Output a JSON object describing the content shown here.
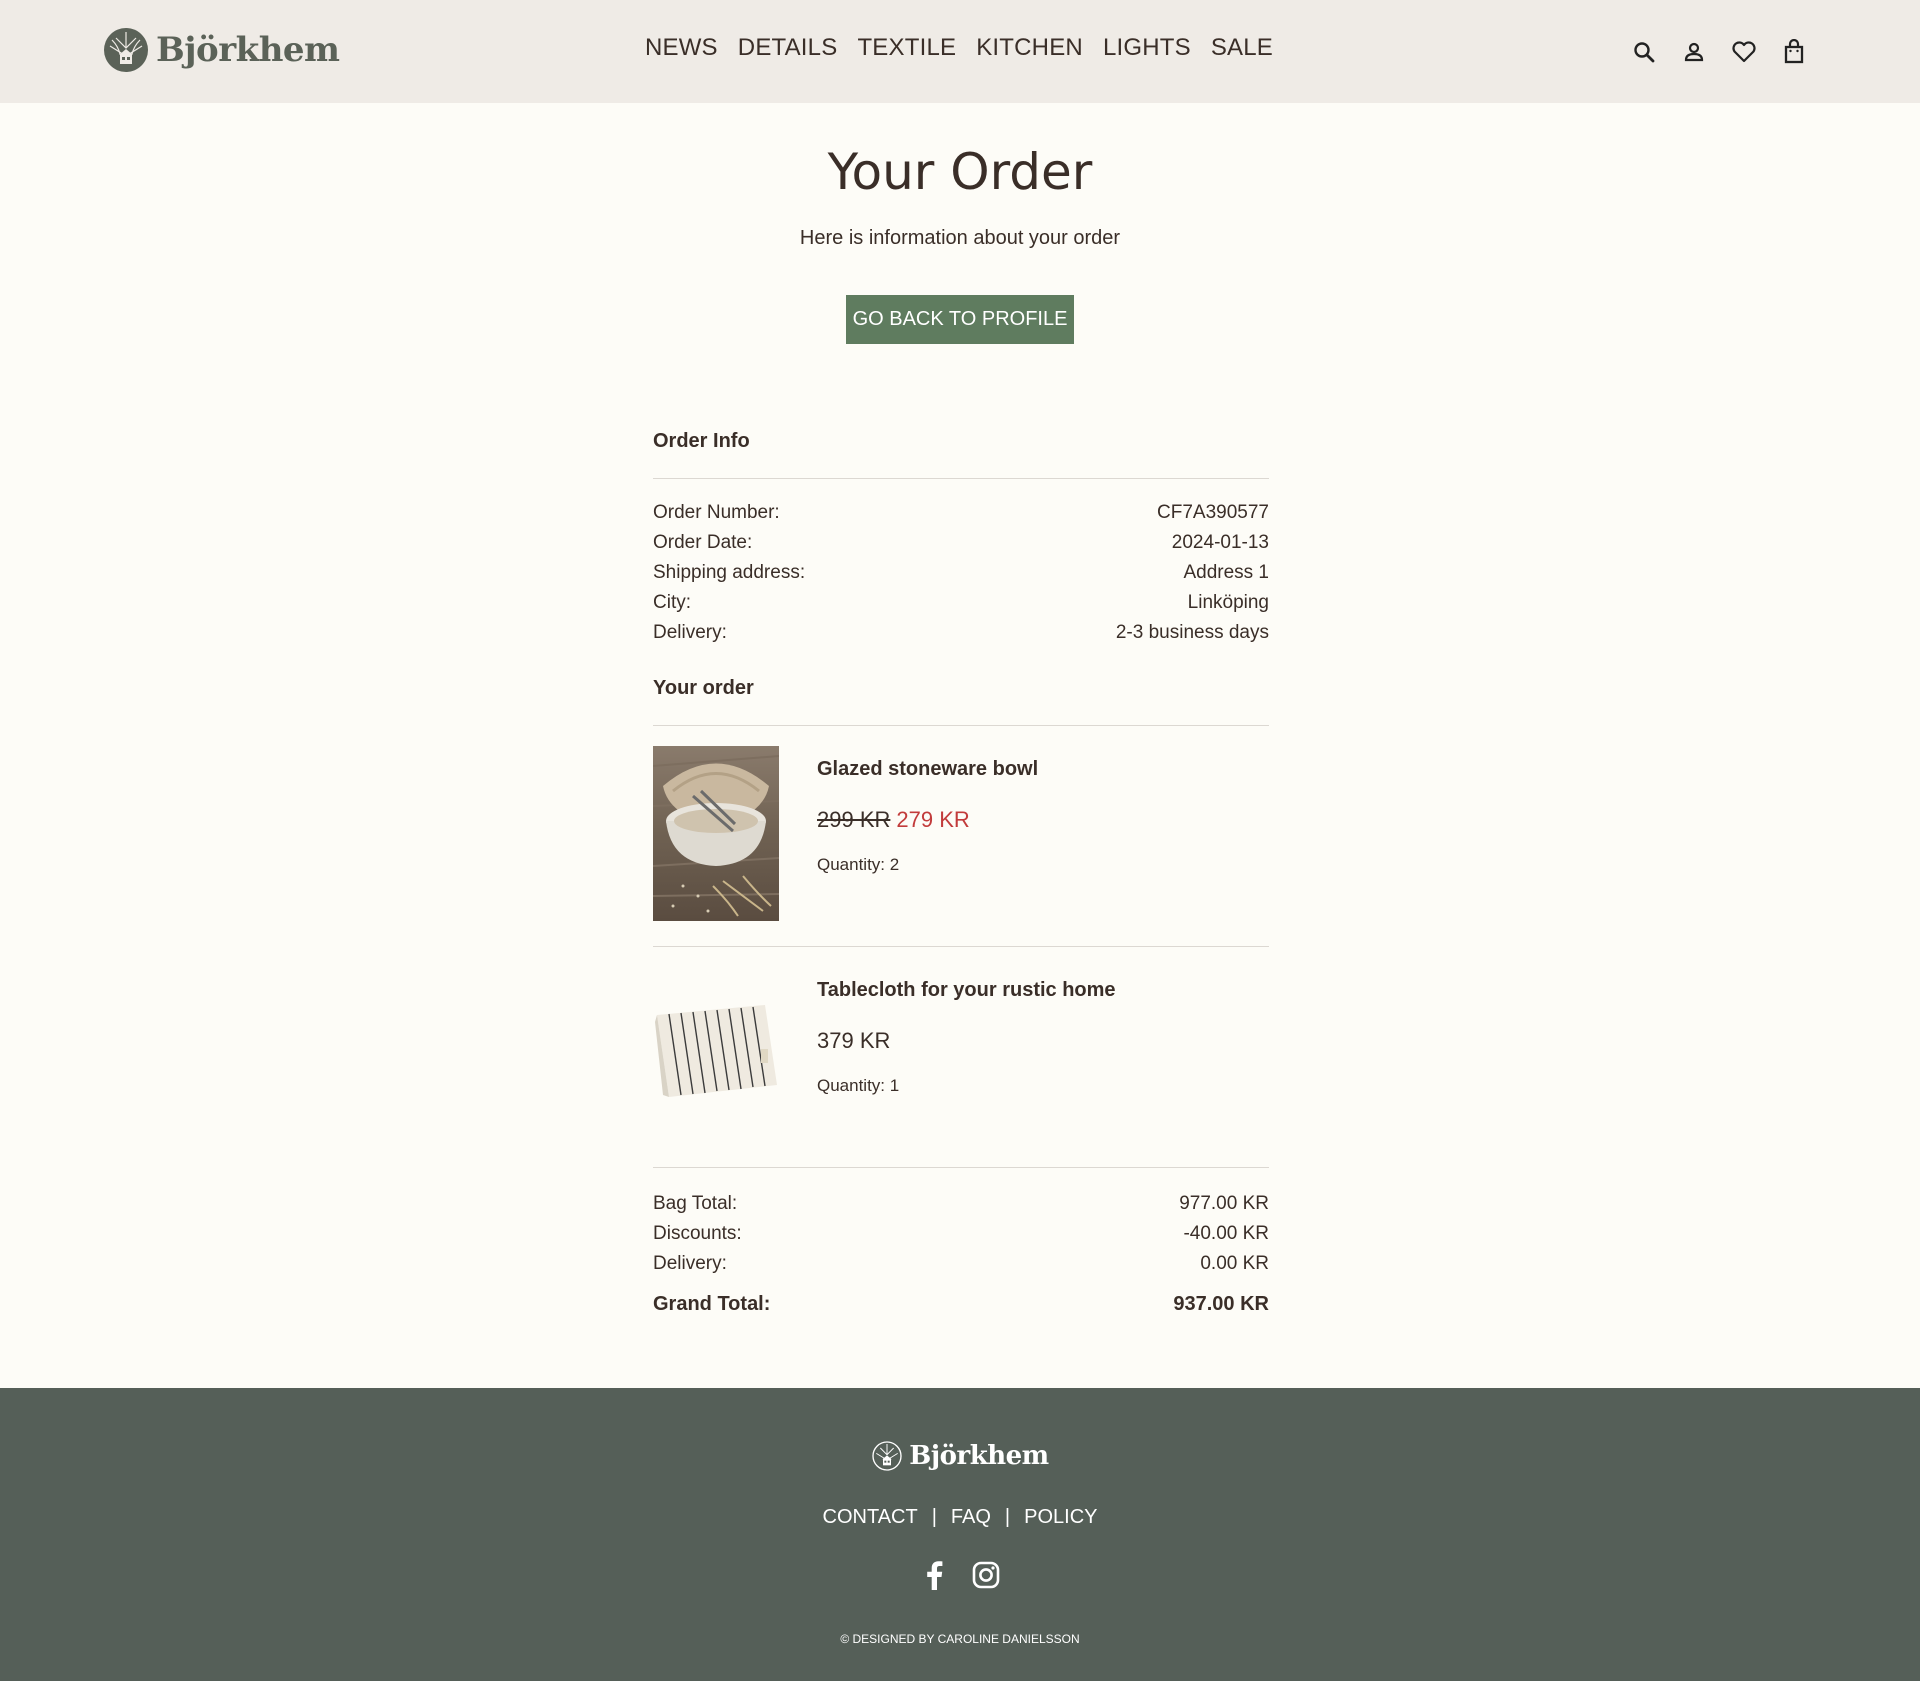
{
  "header": {
    "brand": "Björkhem",
    "nav": [
      "NEWS",
      "DETAILS",
      "TEXTILE",
      "KITCHEN",
      "LIGHTS",
      "SALE"
    ],
    "icons": [
      "search-icon",
      "user-icon",
      "heart-icon",
      "shopping-bag-icon"
    ]
  },
  "page": {
    "title": "Your Order",
    "subtitle": "Here is information about your order",
    "back_button": "GO BACK TO PROFILE"
  },
  "order_info": {
    "heading": "Order Info",
    "rows": [
      {
        "label": "Order Number:",
        "value": "CF7A390577"
      },
      {
        "label": "Order Date:",
        "value": "2024-01-13"
      },
      {
        "label": "Shipping address:",
        "value": "Address 1"
      },
      {
        "label": "City:",
        "value": "Linköping"
      },
      {
        "label": "Delivery:",
        "value": "2-3 business days"
      }
    ]
  },
  "your_order": {
    "heading": "Your order",
    "items": [
      {
        "name": "Glazed stoneware bowl",
        "old_price": "299 KR",
        "price": "279 KR",
        "quantity": "Quantity: 2",
        "image": "bowl-image"
      },
      {
        "name": "Tablecloth for your rustic home",
        "price": "379 KR",
        "quantity": "Quantity: 1",
        "image": "tablecloth-image"
      }
    ]
  },
  "totals": {
    "rows": [
      {
        "label": "Bag Total:",
        "value": "977.00 KR"
      },
      {
        "label": "Discounts:",
        "value": "-40.00 KR"
      },
      {
        "label": "Delivery:",
        "value": "0.00 KR"
      }
    ],
    "grand_label": "Grand Total:",
    "grand_value": "937.00 KR"
  },
  "footer": {
    "brand": "Björkhem",
    "links": [
      "CONTACT",
      "FAQ",
      "POLICY"
    ],
    "separator": "|",
    "social": [
      "facebook-icon",
      "instagram-icon"
    ],
    "copyright": "© DESIGNED BY CAROLINE DANIELSSON"
  },
  "colors": {
    "header_bg": "#efebe6",
    "page_bg": "#fdfcf7",
    "accent_green": "#5f7c5f",
    "footer_bg": "#555f58",
    "sale_red": "#c23b3b",
    "text": "#3a2e28"
  }
}
